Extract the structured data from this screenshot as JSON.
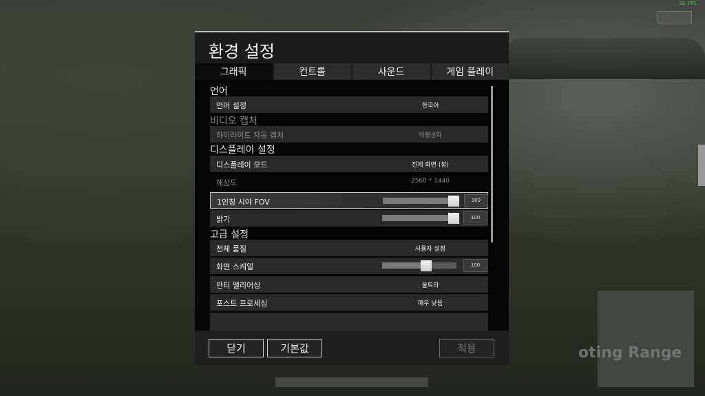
{
  "hud": {
    "fps": "82 FPS",
    "background_sign": "oting Range"
  },
  "dialog": {
    "title": "환경 설정",
    "tabs": [
      {
        "label": "그래픽",
        "active": true
      },
      {
        "label": "컨트롤",
        "active": false
      },
      {
        "label": "사운드",
        "active": false
      },
      {
        "label": "게임 플레이",
        "active": false
      }
    ],
    "sections": {
      "language": {
        "header": "언어",
        "language_setting": {
          "label": "언어 설정",
          "value": "한국어"
        }
      },
      "video_capture": {
        "header": "비디오 캡처",
        "highlight_auto_capture": {
          "label": "하이라이트 자동 캡처",
          "value": "비활성화"
        }
      },
      "display": {
        "header": "디스플레이 설정",
        "display_mode": {
          "label": "디스플레이 모드",
          "value": "전체 화면 (창)"
        },
        "resolution": {
          "label": "해상도",
          "value": "2560 * 1440"
        },
        "fov": {
          "label": "1인칭 시야 FOV",
          "value": "103",
          "fraction": 0.99
        },
        "brightness": {
          "label": "밝기",
          "value": "100",
          "fraction": 1.0
        }
      },
      "advanced": {
        "header": "고급 설정",
        "overall_quality": {
          "label": "전체 품질",
          "value": "사용자 설정"
        },
        "screen_scale": {
          "label": "화면 스케일",
          "value": "100",
          "fraction": 0.6
        },
        "anti_aliasing": {
          "label": "안티 앨리어싱",
          "value": "울트라"
        },
        "post_processing": {
          "label": "포스트 프로세싱",
          "value": "매우 낮음"
        }
      }
    },
    "buttons": {
      "close": "닫기",
      "default": "기본값",
      "apply": "적용"
    }
  },
  "colors": {
    "dialog_bg": "#1b1b1b",
    "row_bg": "#2a2a2a",
    "fps_text": "#3bd13b",
    "disabled_text": "#8a8a8a"
  }
}
